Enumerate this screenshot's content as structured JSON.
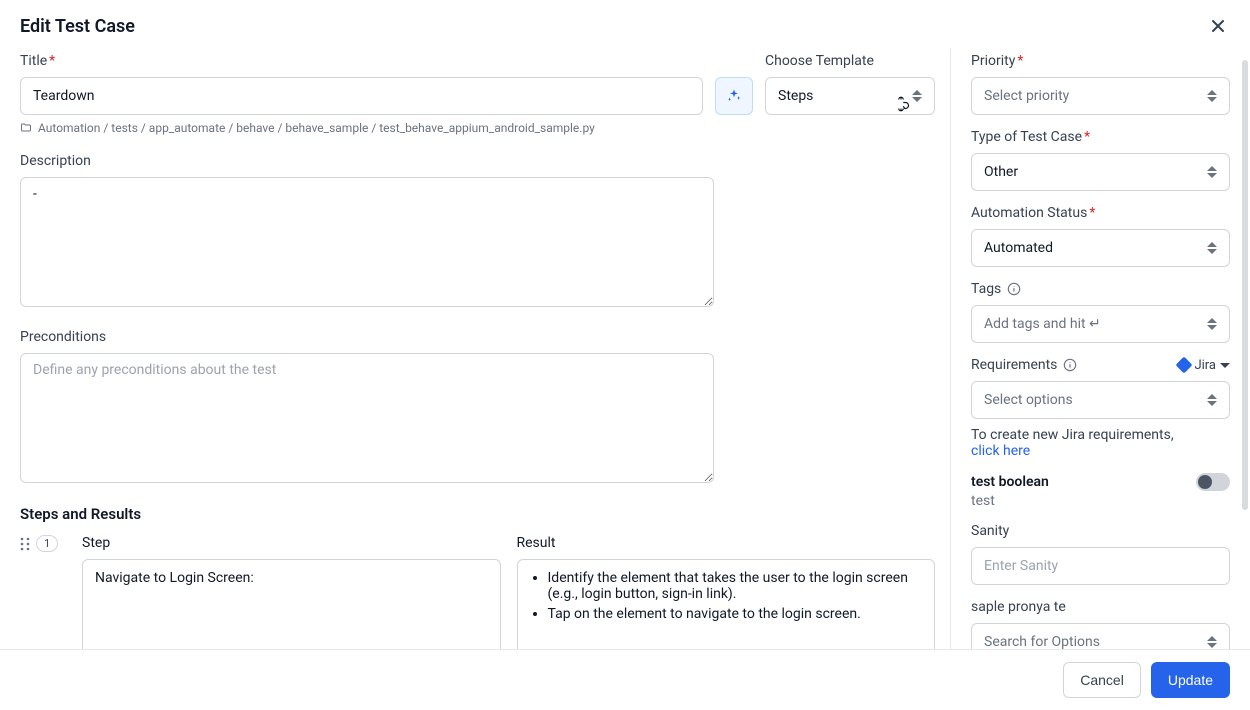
{
  "header": {
    "title": "Edit Test Case"
  },
  "main": {
    "title_label": "Title",
    "title_value": "Teardown",
    "template_label": "Choose Template",
    "template_value": "Steps",
    "breadcrumb": "Automation / tests / app_automate / behave / behave_sample / test_behave_appium_android_sample.py",
    "description_label": "Description",
    "description_value": "-",
    "preconditions_label": "Preconditions",
    "preconditions_placeholder": "Define any preconditions about the test",
    "steps_section_title": "Steps and Results",
    "step_header": "Step",
    "result_header": "Result",
    "steps": [
      {
        "index": "1",
        "step": "Navigate to Login Screen:",
        "result_items": [
          "Identify the element that takes the user to the login screen (e.g., login button, sign-in link).",
          "Tap on the element to navigate to the login screen."
        ]
      }
    ]
  },
  "sidebar": {
    "priority_label": "Priority",
    "priority_placeholder": "Select priority",
    "type_label": "Type of Test Case",
    "type_value": "Other",
    "automation_label": "Automation Status",
    "automation_value": "Automated",
    "tags_label": "Tags",
    "tags_placeholder": "Add tags and hit ↵",
    "requirements_label": "Requirements",
    "requirements_placeholder": "Select options",
    "requirements_hint_prefix": "To create new Jira requirements, ",
    "requirements_hint_link": "click here",
    "jira_label": "Jira",
    "bool_label": "test boolean",
    "bool_sub": "test",
    "sanity_label": "Sanity",
    "sanity_placeholder": "Enter Sanity",
    "saple_label": "saple pronya te",
    "saple_placeholder": "Search for Options"
  },
  "footer": {
    "cancel": "Cancel",
    "update": "Update"
  }
}
